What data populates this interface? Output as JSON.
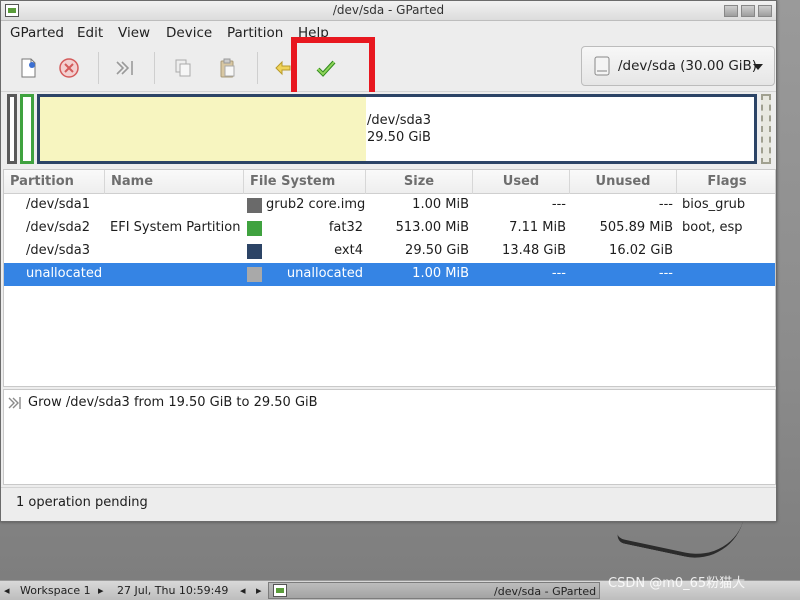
{
  "window": {
    "title": "/dev/sda - GParted"
  },
  "menubar": {
    "items": [
      "GParted",
      "Edit",
      "View",
      "Device",
      "Partition",
      "Help"
    ]
  },
  "toolbar": {
    "new_icon": "new-partition-icon",
    "delete_icon": "delete-partition-icon",
    "resize_icon": "resize-move-icon",
    "copy_icon": "copy-icon",
    "paste_icon": "paste-icon",
    "undo_icon": "undo-icon",
    "apply_icon": "apply-checkmark-icon",
    "highlight_color": "#e8171f"
  },
  "device_selector": {
    "value": "/dev/sda (30.00 GiB)"
  },
  "partition_map": {
    "sda3_name": "/dev/sda3",
    "sda3_size": "29.50 GiB",
    "used_fraction": 0.457
  },
  "table": {
    "columns": [
      "Partition",
      "Name",
      "File System",
      "Size",
      "Used",
      "Unused",
      "Flags"
    ],
    "rows": [
      {
        "partition": "/dev/sda1",
        "name": "",
        "fs": "grub2 core.img",
        "fs_color": "#6a6a6a",
        "size": "1.00 MiB",
        "used": "---",
        "unused": "---",
        "flags": "bios_grub"
      },
      {
        "partition": "/dev/sda2",
        "name": "EFI System Partition",
        "fs": "fat32",
        "fs_color": "#3fa23f",
        "size": "513.00 MiB",
        "used": "7.11 MiB",
        "unused": "505.89 MiB",
        "flags": "boot, esp"
      },
      {
        "partition": "/dev/sda3",
        "name": "",
        "fs": "ext4",
        "fs_color": "#2c4466",
        "size": "29.50 GiB",
        "used": "13.48 GiB",
        "unused": "16.02 GiB",
        "flags": ""
      },
      {
        "partition": "unallocated",
        "name": "",
        "fs": "unallocated",
        "fs_color": "#a9a9a9",
        "size": "1.00 MiB",
        "used": "---",
        "unused": "---",
        "flags": ""
      }
    ]
  },
  "operations": {
    "items": [
      "Grow /dev/sda3 from 19.50 GiB to 29.50 GiB"
    ]
  },
  "status": {
    "text": "1 operation pending"
  },
  "taskbar": {
    "workspace": "Workspace 1",
    "datetime": "27 Jul, Thu 10:59:49",
    "task": "/dev/sda - GParted"
  },
  "watermark": "CSDN @m0_65粉猫大"
}
